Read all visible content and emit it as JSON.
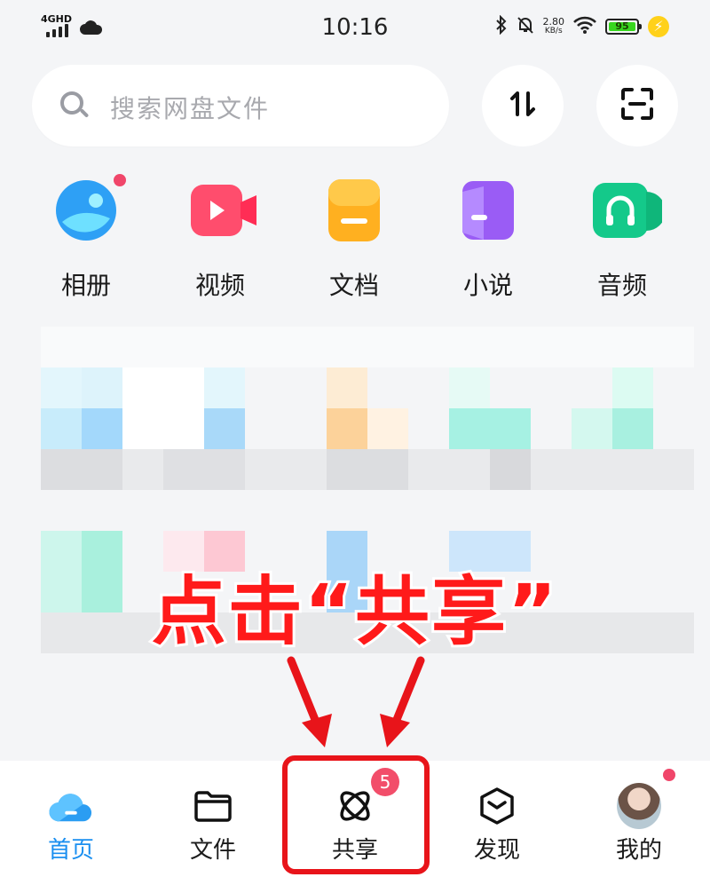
{
  "status_bar": {
    "network": "4GHD",
    "time": "10:16",
    "speed_value": "2.80",
    "speed_unit": "KB/s",
    "battery": "95",
    "icons": [
      "signal-icon",
      "cloud-icon",
      "bluetooth-icon",
      "mute-icon",
      "wifi-icon",
      "battery-icon",
      "charging-icon"
    ]
  },
  "search": {
    "placeholder": "搜索网盘文件",
    "icon": "search-icon"
  },
  "header_buttons": [
    {
      "name": "sort",
      "icon": "sort-arrows-icon"
    },
    {
      "name": "scan",
      "icon": "scan-icon"
    }
  ],
  "categories": [
    {
      "label": "相册",
      "icon": "album-icon",
      "color": "#2ea0f5",
      "has_dot": true
    },
    {
      "label": "视频",
      "icon": "video-icon",
      "color": "#ff4d6d"
    },
    {
      "label": "文档",
      "icon": "document-icon",
      "color": "#ffb020"
    },
    {
      "label": "小说",
      "icon": "novel-icon",
      "color": "#9a5cf5"
    },
    {
      "label": "音频",
      "icon": "audio-icon",
      "color": "#14c98a"
    }
  ],
  "overlay": {
    "text": "点击“共享”",
    "color": "#ff1a1a"
  },
  "bottom_nav": {
    "items": [
      {
        "label": "首页",
        "icon": "cloud-home-icon",
        "active": true
      },
      {
        "label": "文件",
        "icon": "folder-icon"
      },
      {
        "label": "共享",
        "icon": "share-orbit-icon",
        "badge": "5",
        "highlighted": true
      },
      {
        "label": "发现",
        "icon": "discover-cube-icon"
      },
      {
        "label": "我的",
        "icon": "avatar-icon",
        "has_dot": true
      }
    ]
  },
  "colors": {
    "accent": "#1a8ff0",
    "highlight_red": "#e8141a",
    "badge": "#f24e6a",
    "background": "#f4f5f7"
  }
}
